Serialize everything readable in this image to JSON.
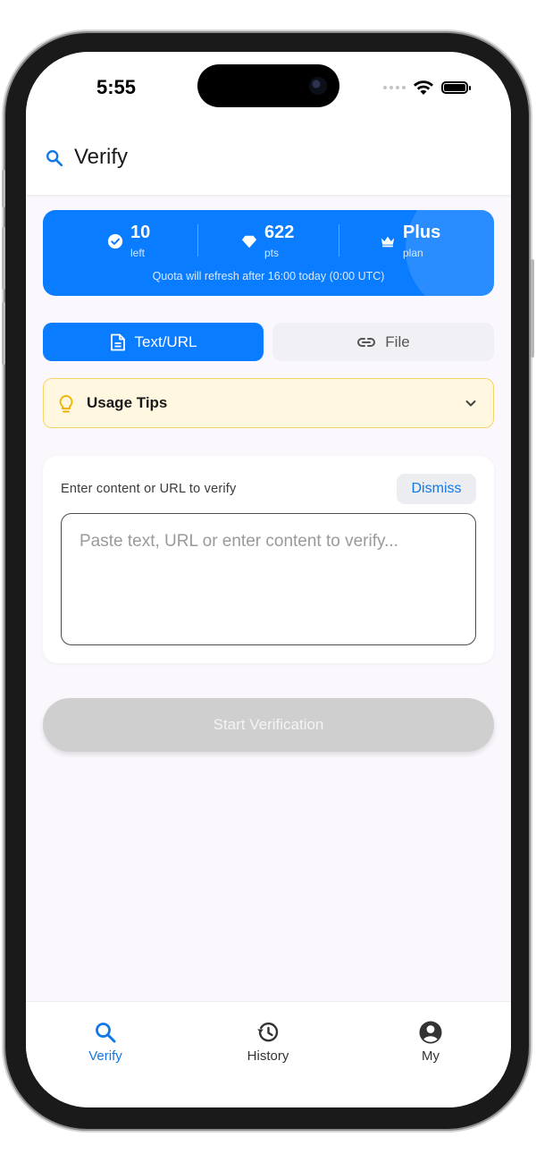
{
  "status_bar": {
    "time": "5:55"
  },
  "app_bar": {
    "title": "Verify"
  },
  "quota": {
    "remaining_value": "10",
    "remaining_label": "left",
    "points_value": "622",
    "points_label": "pts",
    "plan_value": "Plus",
    "plan_label": "plan",
    "refresh_note": "Quota will refresh after 16:00 today (0:00 UTC)"
  },
  "mode_tabs": {
    "text_url_label": "Text/URL",
    "file_label": "File",
    "selected": "Text/URL"
  },
  "usage_tips": {
    "label": "Usage Tips"
  },
  "input_card": {
    "label": "Enter content or URL to verify",
    "dismiss_label": "Dismiss",
    "placeholder": "Paste text, URL or enter content to verify..."
  },
  "start_button": {
    "label": "Start Verification"
  },
  "bottom_nav": {
    "items": [
      {
        "label": "Verify",
        "icon": "search-icon",
        "active": true
      },
      {
        "label": "History",
        "icon": "history-icon",
        "active": false
      },
      {
        "label": "My",
        "icon": "account-circle-icon",
        "active": false
      }
    ]
  },
  "colors": {
    "accent": "#0a7cff",
    "tips_bg": "#fff7e0",
    "tips_border": "#f5d56a",
    "disabled_button": "#cfcfcf"
  }
}
